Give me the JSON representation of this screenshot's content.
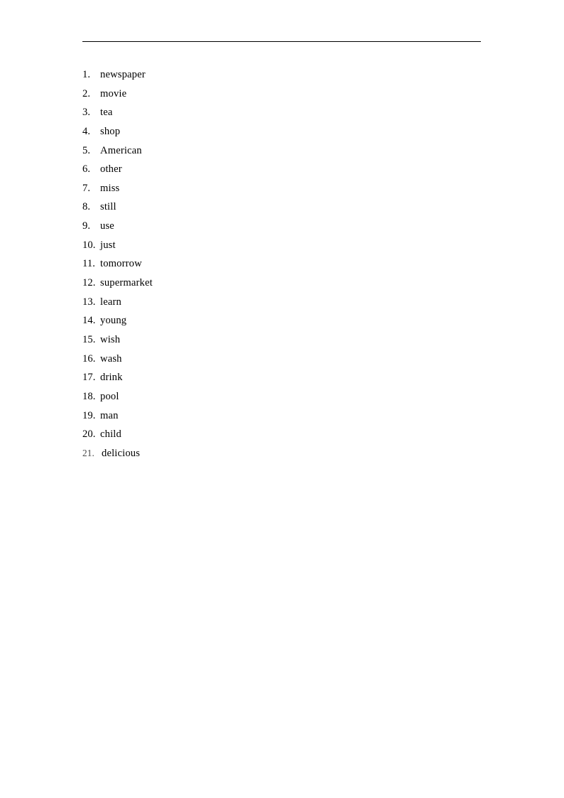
{
  "document": {
    "page_background": "#ffffff",
    "text_color": "#000000",
    "rule_color": "#000000"
  },
  "header": {
    "rule": "horizontal-rule"
  },
  "word_list": {
    "items": [
      {
        "number": "1.",
        "word": "newspaper"
      },
      {
        "number": "2.",
        "word": "movie"
      },
      {
        "number": "3.",
        "word": "tea"
      },
      {
        "number": "4.",
        "word": "shop"
      },
      {
        "number": "5.",
        "word": "American"
      },
      {
        "number": "6.",
        "word": "other"
      },
      {
        "number": "7.",
        "word": "miss"
      },
      {
        "number": "8.",
        "word": "still"
      },
      {
        "number": "9.",
        "word": "use"
      },
      {
        "number": "10.",
        "word": "just"
      },
      {
        "number": "11.",
        "word": "tomorrow"
      },
      {
        "number": "12.",
        "word": "supermarket"
      },
      {
        "number": "13.",
        "word": "learn"
      },
      {
        "number": "14.",
        "word": "young"
      },
      {
        "number": "15.",
        "word": "wish"
      },
      {
        "number": "16.",
        "word": "wash"
      },
      {
        "number": "17.",
        "word": "drink"
      },
      {
        "number": "18.",
        "word": "pool"
      },
      {
        "number": "19.",
        "word": "man"
      },
      {
        "number": "20.",
        "word": "child"
      },
      {
        "number": "21.",
        "word": "delicious"
      }
    ]
  }
}
